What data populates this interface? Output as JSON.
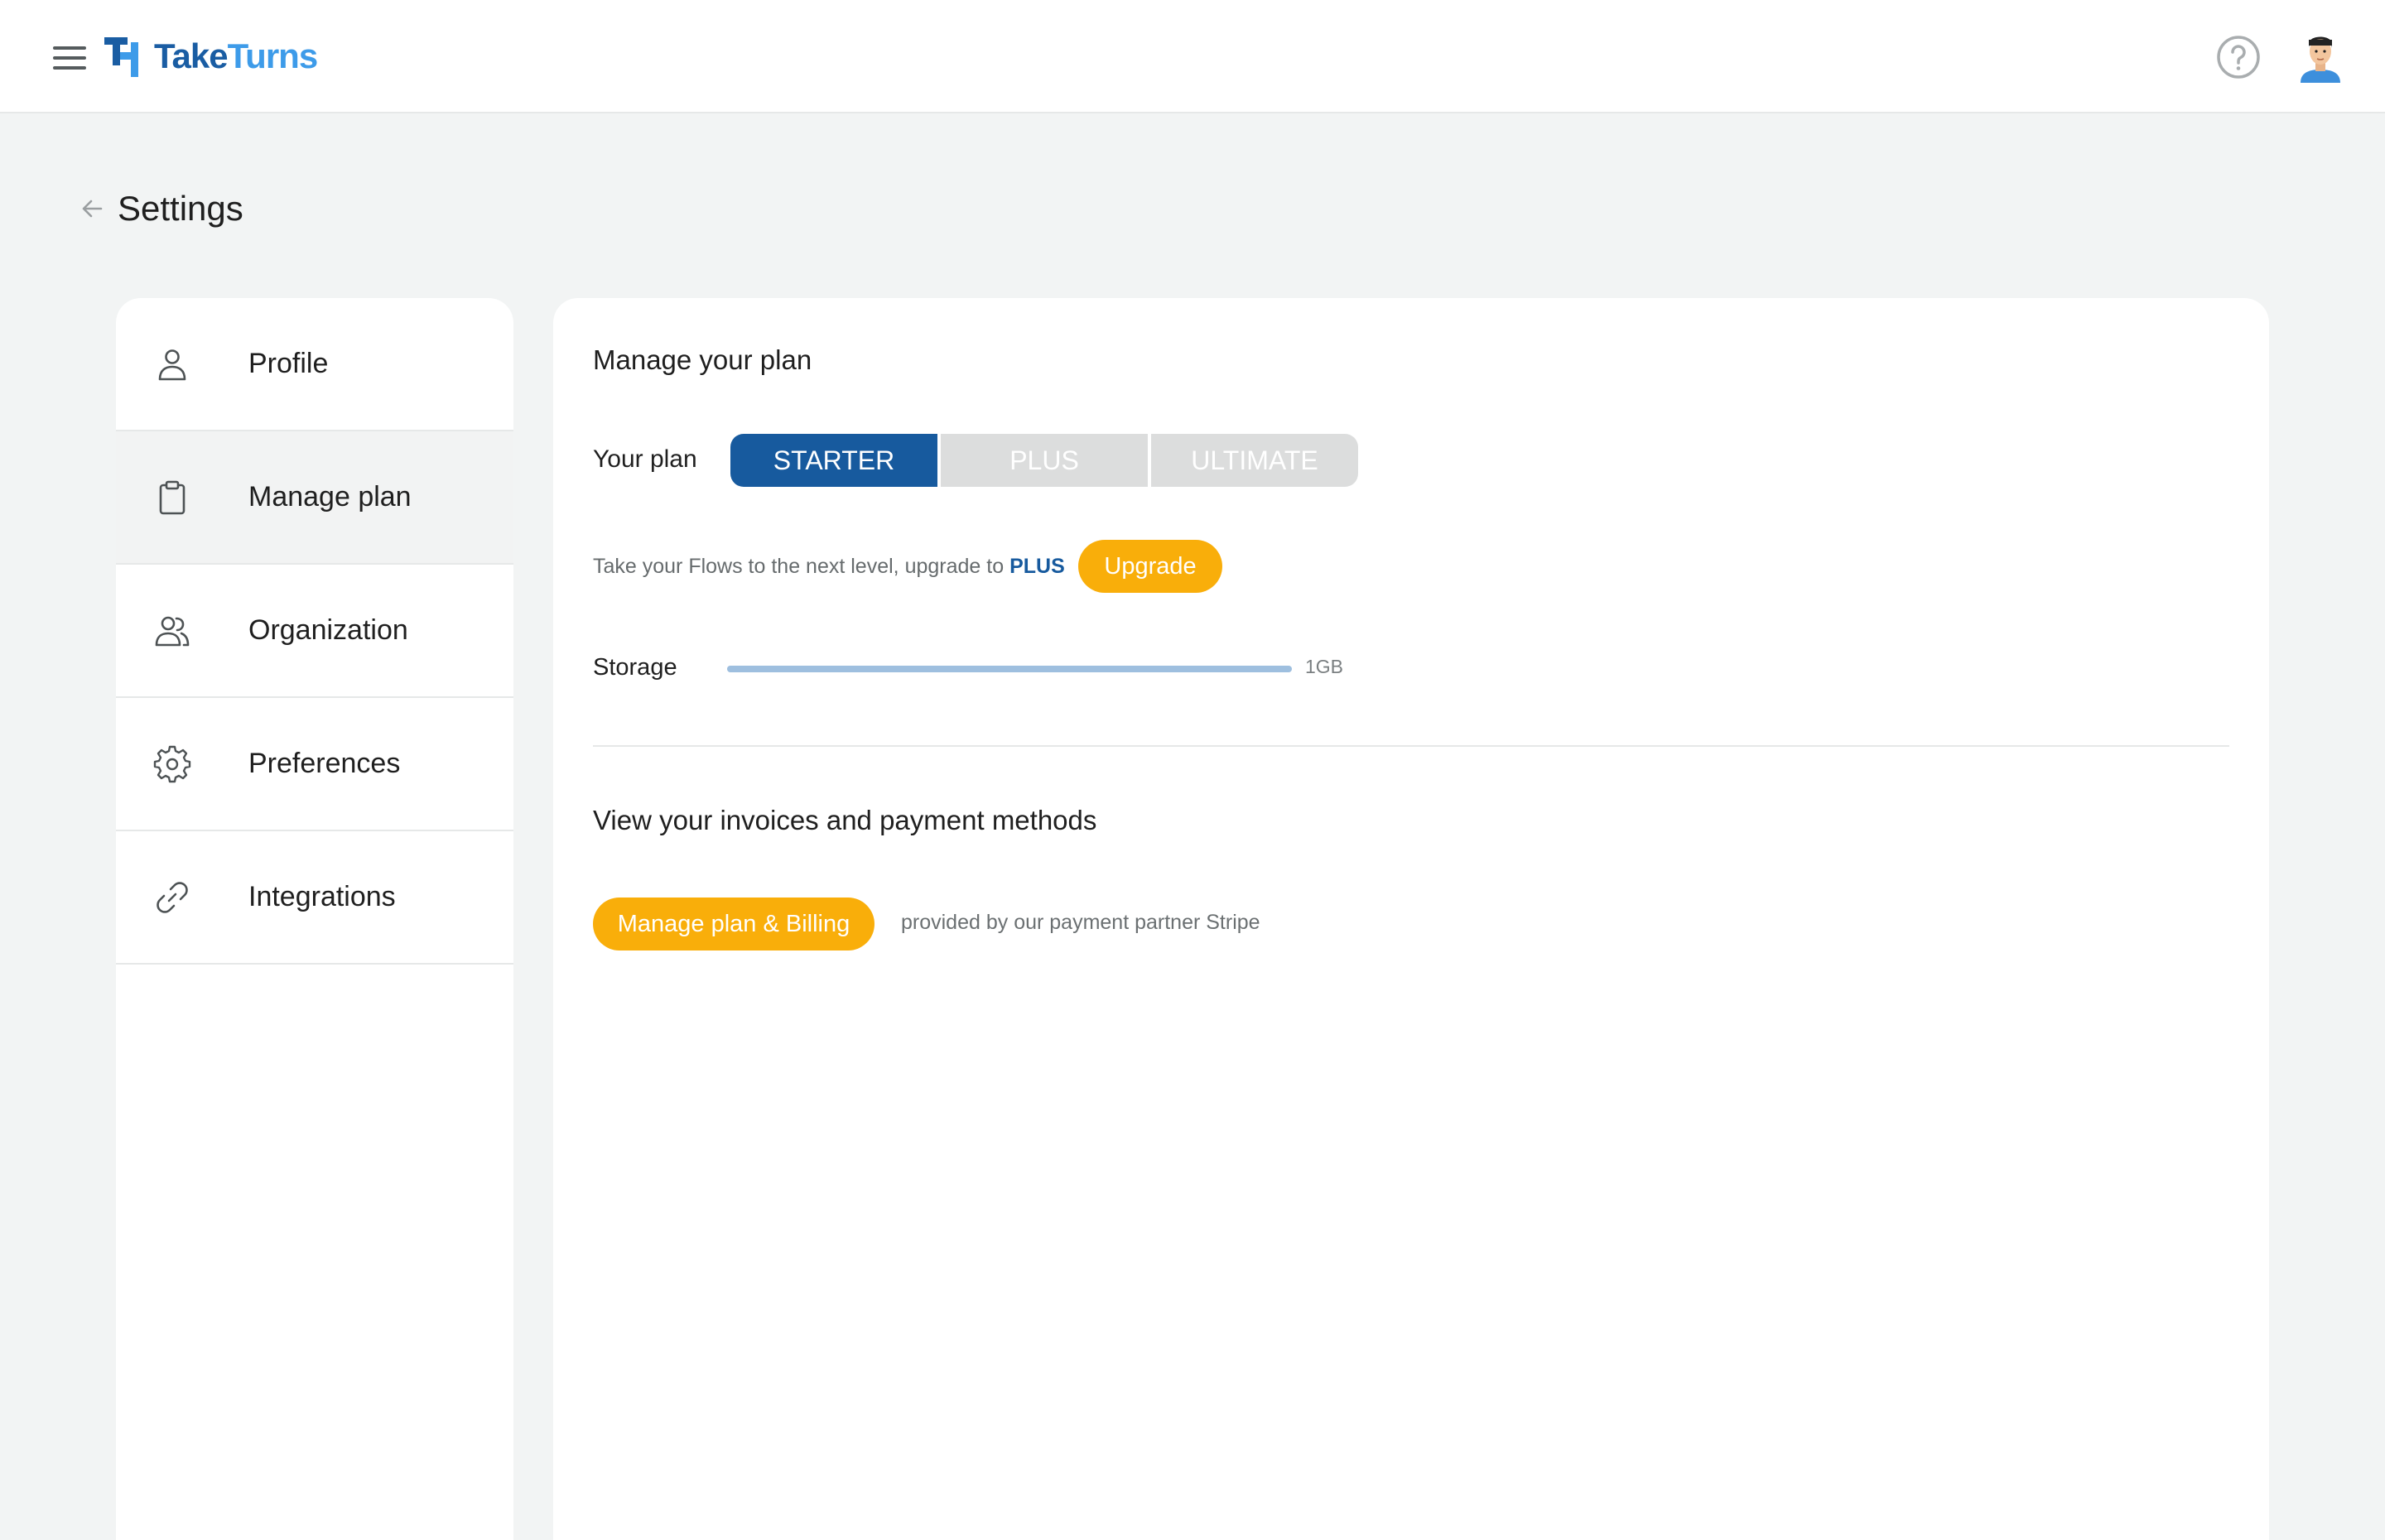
{
  "topbar": {
    "menu_icon": "hamburger-menu-icon",
    "logo": {
      "take": "Take",
      "turns": "Turns"
    },
    "help_icon": "help-circle-icon",
    "avatar_icon": "user-avatar"
  },
  "page": {
    "back_icon": "arrow-left-icon",
    "title": "Settings"
  },
  "sidebar": {
    "items": [
      {
        "label": "Profile",
        "icon": "user-icon",
        "active": false
      },
      {
        "label": "Manage plan",
        "icon": "clipboard-icon",
        "active": true
      },
      {
        "label": "Organization",
        "icon": "users-icon",
        "active": false
      },
      {
        "label": "Preferences",
        "icon": "gear-icon",
        "active": false
      },
      {
        "label": "Integrations",
        "icon": "link-icon",
        "active": false
      }
    ]
  },
  "plan": {
    "heading": "Manage your plan",
    "your_plan_label": "Your plan",
    "options": [
      "STARTER",
      "PLUS",
      "ULTIMATE"
    ],
    "selected": "STARTER",
    "upgrade_text": "Take your Flows to the next level, upgrade to",
    "upgrade_target": "PLUS",
    "upgrade_button": "Upgrade",
    "storage_label": "Storage",
    "storage_capacity": "1GB",
    "storage_used_fraction": 1.0
  },
  "billing": {
    "heading": "View your invoices and payment methods",
    "button": "Manage plan & Billing",
    "note": "provided by our payment partner Stripe"
  },
  "colors": {
    "primary": "#175a9e",
    "accent": "#f9ae0a",
    "background": "#f2f4f4",
    "inactive_toggle": "#dcdddd"
  }
}
